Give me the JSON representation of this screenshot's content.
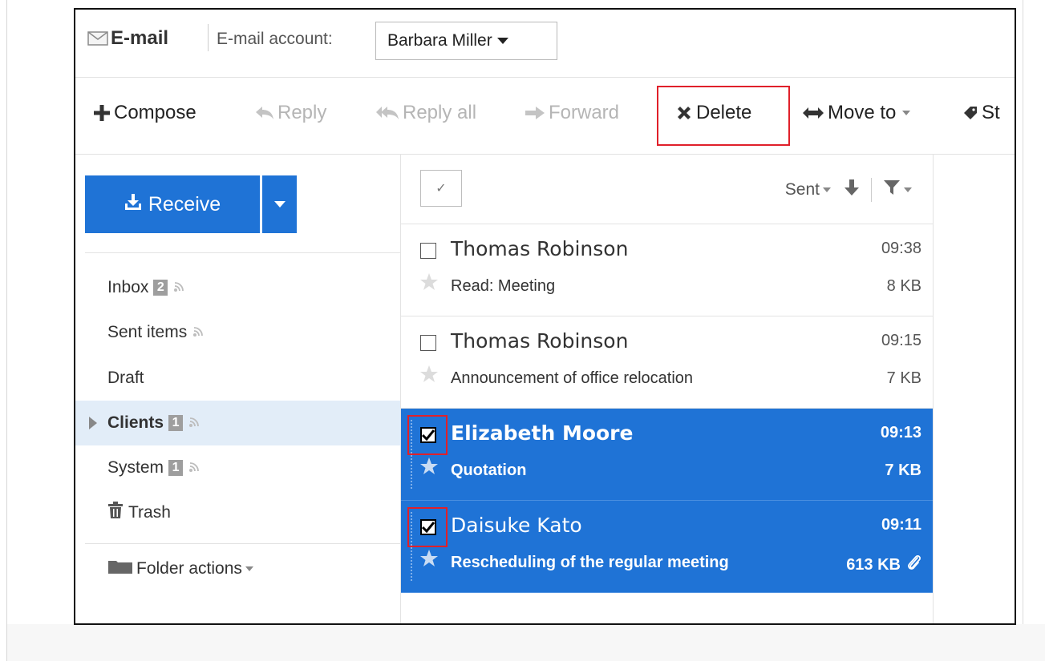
{
  "header": {
    "app_title": "E-mail",
    "account_label": "E-mail account:",
    "account_value": "Barbara Miller"
  },
  "toolbar": {
    "compose": "Compose",
    "reply": "Reply",
    "reply_all": "Reply all",
    "forward": "Forward",
    "delete": "Delete",
    "move_to": "Move to",
    "star_partial": "St"
  },
  "sidebar": {
    "receive_label": "Receive",
    "folders": [
      {
        "label": "Inbox",
        "badge": "2"
      },
      {
        "label": "Sent items",
        "badge": ""
      },
      {
        "label": "Draft",
        "badge": ""
      },
      {
        "label": "Clients",
        "badge": "1"
      },
      {
        "label": "System",
        "badge": "1"
      },
      {
        "label": "Trash",
        "badge": ""
      }
    ],
    "folder_actions": "Folder actions"
  },
  "list_header": {
    "select_all_glyph": "✓",
    "sort_label": "Sent"
  },
  "messages": [
    {
      "sender": "Thomas Robinson",
      "time": "09:38",
      "subject": "Read: Meeting",
      "size": "8 KB",
      "checked": false,
      "unread": false
    },
    {
      "sender": "Thomas Robinson",
      "time": "09:15",
      "subject": "Announcement of office relocation",
      "size": "7 KB",
      "checked": false,
      "unread": false
    },
    {
      "sender": "Elizabeth Moore",
      "time": "09:13",
      "subject": "Quotation",
      "size": "7 KB",
      "checked": true,
      "unread": true
    },
    {
      "sender": "Daisuke Kato",
      "time": "09:11",
      "subject": "Rescheduling of the regular meeting",
      "size": "613 KB",
      "checked": true,
      "unread": false
    }
  ],
  "colors": {
    "accent_blue": "#1f73d6",
    "highlight_red": "#e0202a",
    "selected_folder_bg": "#e2edf8"
  }
}
